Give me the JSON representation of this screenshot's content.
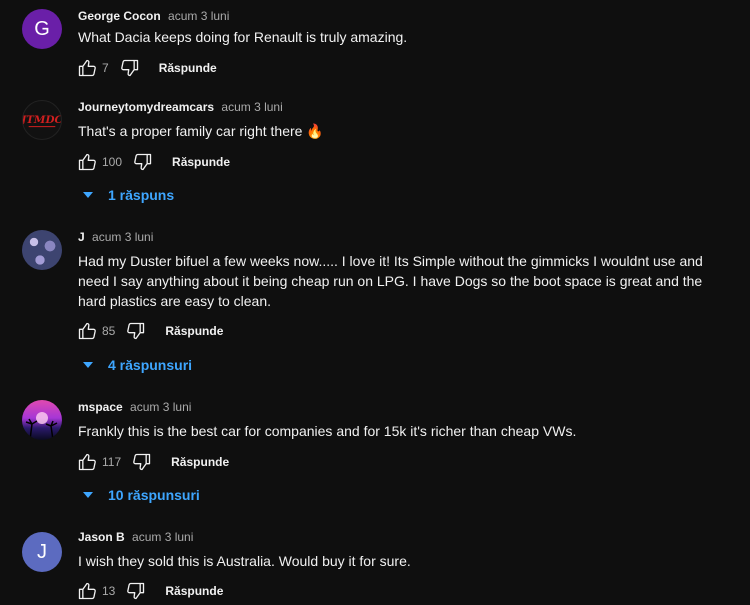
{
  "comments": [
    {
      "author": "George Cocon",
      "time": "acum 3 luni",
      "avatar_letter": "G",
      "avatar_color": "#6a1fa8",
      "text": "What Dacia keeps doing for Renault is truly amazing.",
      "likes": "7",
      "reply_label": "Răspunde"
    },
    {
      "author": "Journeytomydreamcars",
      "time": "acum 3 luni",
      "avatar_logo": "JTMDC",
      "avatar_color": "#111111",
      "text": "That's a proper family car right there 🔥",
      "likes": "100",
      "reply_label": "Răspunde",
      "replies_label": "1 răspuns"
    },
    {
      "author": "J",
      "time": "acum 3 luni",
      "avatar_color": "#3d4470",
      "text": "Had my Duster bifuel a few weeks now..... I love it! Its Simple without the gimmicks I wouldnt use and need I say anything about it being cheap run on LPG. I have Dogs so the boot space is great and the hard plastics are easy to clean.",
      "likes": "85",
      "reply_label": "Răspunde",
      "replies_label": "4 răspunsuri"
    },
    {
      "author": "mspace",
      "time": "acum 3 luni",
      "avatar_color": "#b23bd1",
      "text": "Frankly this is the best car for companies and for 15k it's richer than cheap VWs.",
      "likes": "117",
      "reply_label": "Răspunde",
      "replies_label": "10 răspunsuri"
    },
    {
      "author": "Jason B",
      "time": "acum 3 luni",
      "avatar_letter": "J",
      "avatar_color": "#5c6bc0",
      "text": "I wish they sold this is Australia. Would buy it for sure.",
      "likes": "13",
      "reply_label": "Răspunde"
    }
  ],
  "colors": {
    "background": "#0f0f0f",
    "link_blue": "#3ea6ff",
    "secondary_text": "#aaaaaa"
  }
}
